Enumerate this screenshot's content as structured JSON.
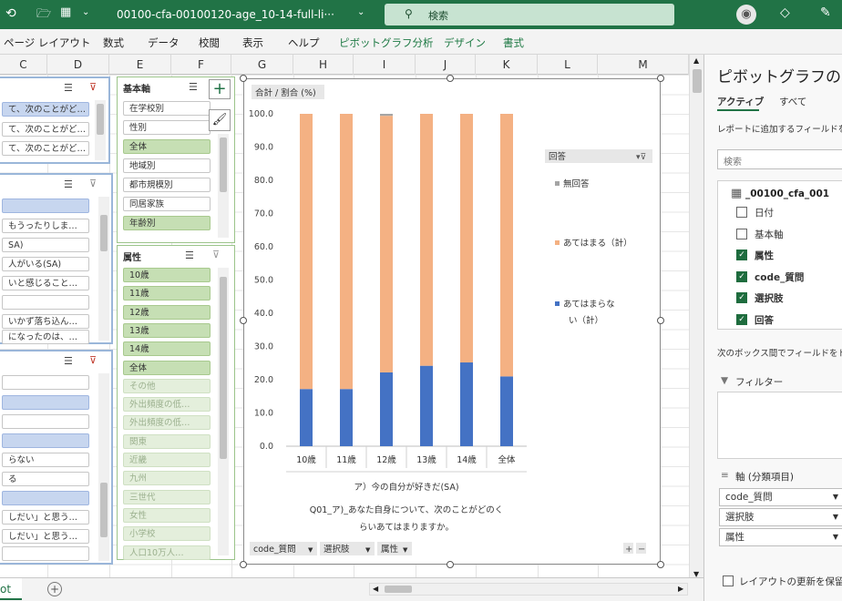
{
  "titlebar": {
    "filename": "00100-cfa-00100120-age_10-14-full-li···",
    "search": "検索"
  },
  "menu": [
    "ページ レイアウト",
    "数式",
    "データ",
    "校閲",
    "表示",
    "ヘルプ",
    "ピボットグラフ分析",
    "デザイン",
    "書式"
  ],
  "columns": [
    "C",
    "D",
    "E",
    "F",
    "G",
    "H",
    "I",
    "J",
    "K",
    "L",
    "M"
  ],
  "slicer_left1": {
    "items": [
      "て、次のことがど…",
      "て、次のことがど…",
      "て、次のことがど…",
      "て、次のことがど…"
    ]
  },
  "slicer_left2": {
    "items": [
      "",
      "もうったりしま…",
      "SA)",
      "人がいる(SA)",
      "いと感じること…",
      "",
      "いかず落ち込ん…",
      "になったのは、…"
    ]
  },
  "slicer_left3": {
    "items": [
      "",
      "",
      "",
      "",
      "らない",
      "る",
      "",
      "しだい」と思う…",
      "しだい」と思う…",
      ""
    ]
  },
  "slicer_kihonjiku": {
    "title": "基本軸",
    "items": [
      "在学校別",
      "性別",
      "全体",
      "地域別",
      "都市規模別",
      "同居家族",
      "年齢別"
    ]
  },
  "slicer_zokusei": {
    "title": "属性",
    "items": [
      "10歳",
      "11歳",
      "12歳",
      "13歳",
      "14歳",
      "全体",
      "その他",
      "外出頻度の低…",
      "外出頻度の低…",
      "関東",
      "近畿",
      "九州",
      "三世代",
      "女性",
      "小学校",
      "人口10万人…"
    ]
  },
  "chart": {
    "title_button": "合計 / 割合 (%)",
    "legend_title": "回答",
    "legend_items": [
      "無回答",
      "あてはまる（計）",
      "あてはまらない（計）"
    ],
    "axis_caption1": "ア）今の自分が好きだ(SA)",
    "axis_caption2": "Q01_ア)_あなた自身について、次のことがどのくらいあてはまりますか。",
    "field_buttons": [
      "code_質問",
      "選択肢",
      "属性"
    ],
    "colors": {
      "noanswer": "#a5a5a5",
      "agree": "#f4b183",
      "disagree": "#4472c4"
    }
  },
  "chart_data": {
    "type": "bar",
    "stacked": true,
    "categories": [
      "10歳",
      "11歳",
      "12歳",
      "13歳",
      "14歳",
      "全体"
    ],
    "series": [
      {
        "name": "あてはまらない（計）",
        "values": [
          17.2,
          17.2,
          22.2,
          24.2,
          25.2,
          21.0
        ]
      },
      {
        "name": "あてはまる（計）",
        "values": [
          82.8,
          82.8,
          77.2,
          75.8,
          74.8,
          79.0
        ]
      },
      {
        "name": "無回答",
        "values": [
          0.0,
          0.0,
          0.6,
          0.0,
          0.0,
          0.0
        ]
      }
    ],
    "yticks": [
      "0.0",
      "10.0",
      "20.0",
      "30.0",
      "40.0",
      "50.0",
      "60.0",
      "70.0",
      "80.0",
      "90.0",
      "100.0"
    ],
    "ylim": [
      0,
      100
    ],
    "grid": false,
    "legend": "right"
  },
  "pane": {
    "title": "ピボットグラフのフィ",
    "tab_active": "アクティブ",
    "tab_all": "すべて",
    "hint": "レポートに追加するフィールドを選",
    "search": "検索",
    "table": "_00100_cfa_001",
    "fields": [
      {
        "label": "日付",
        "checked": false
      },
      {
        "label": "基本軸",
        "checked": false
      },
      {
        "label": "属性",
        "checked": true
      },
      {
        "label": "code_質問",
        "checked": true
      },
      {
        "label": "選択肢",
        "checked": true
      },
      {
        "label": "回答",
        "checked": true
      }
    ],
    "drag_hint": "次のボックス間でフィールドをドラ",
    "filter_label": "フィルター",
    "axis_label": "軸 (分類項目)",
    "axis_fields": [
      "code_質問",
      "選択肢",
      "属性"
    ],
    "defer": "レイアウトの更新を保留す"
  },
  "status": {
    "sheet_tab": "ot"
  }
}
